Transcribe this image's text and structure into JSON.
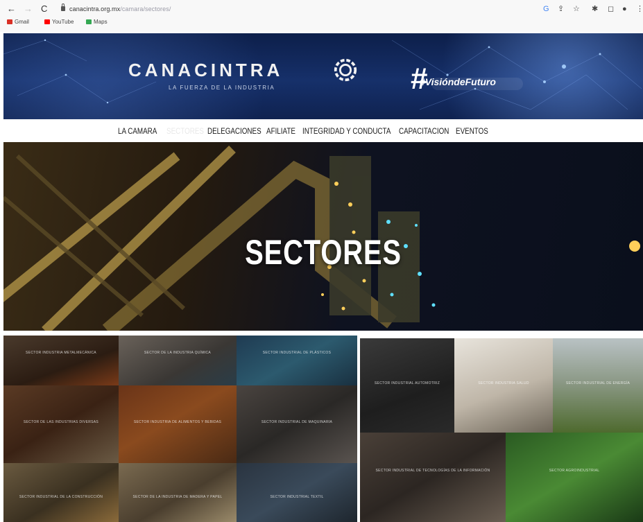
{
  "browser": {
    "url_domain": "canacintra.org.mx",
    "url_path": "/camara/sectores/",
    "bookmarks": [
      {
        "label": "Gmail",
        "icon": "gmail-icon",
        "color": "#d93025"
      },
      {
        "label": "YouTube",
        "icon": "youtube-icon",
        "color": "#ff0000"
      },
      {
        "label": "Maps",
        "icon": "maps-icon",
        "color": "#34a853"
      }
    ]
  },
  "header": {
    "logo_text": "CANACINTRA",
    "tagline": "LA FUERZA DE LA INDUSTRIA",
    "campaign": "#VisióndeFuturo"
  },
  "nav": {
    "items": [
      "LA CAMARA",
      "SECTORES",
      "DELEGACIONES",
      "AFILIATE",
      "INTEGRIDAD Y CONDUCTA",
      "CAPACITACION",
      "EVENTOS"
    ],
    "active_index": 1
  },
  "hero": {
    "title": "SECTORES"
  },
  "sectors": [
    {
      "label": "SECTOR INDUSTRIA METALMECÁNICA"
    },
    {
      "label": "SECTOR DE LA INDUSTRIA QUÍMICA"
    },
    {
      "label": "SECTOR INDUSTRIAL DE PLÁSTICOS"
    },
    {
      "label": "SECTOR INDUSTRIAL AUTOMOTRIZ"
    },
    {
      "label": "SECTOR INDUSTRIA SALUD"
    },
    {
      "label": "SECTOR INDUSTRIAL DE ENERGÍA"
    },
    {
      "label": "SECTOR DE LAS INDUSTRIAS DIVERSAS"
    },
    {
      "label": "SECTOR INDUSTRIA DE ALIMENTOS Y BEBIDAS"
    },
    {
      "label": "SECTOR INDUSTRIAL DE MAQUINARIA"
    },
    {
      "label": "SECTOR INDUSTRIAL DE TECNOLOGÍAS DE LA INFORMACIÓN"
    },
    {
      "label": "SECTOR AGROINDUSTRIAL"
    },
    {
      "label": "SECTOR INDUSTRIAL DE LA CONSTRUCCIÓN"
    },
    {
      "label": "SECTOR DE LA INDUSTRIA DE MADERA Y PAPEL"
    },
    {
      "label": "SECTOR INDUSTRIAL TEXTIL"
    }
  ]
}
